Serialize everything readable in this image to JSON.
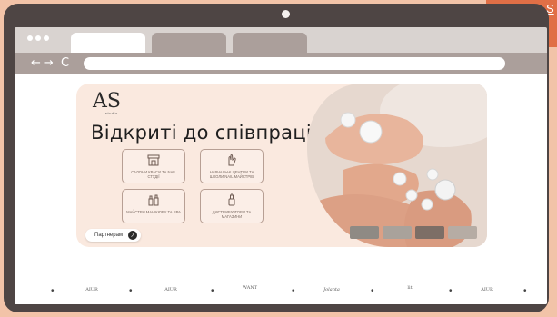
{
  "corner_tag": {
    "text": "S"
  },
  "browser": {
    "tabs": [
      {
        "label": "",
        "active": true
      },
      {
        "label": "",
        "active": false
      },
      {
        "label": "",
        "active": false
      }
    ],
    "nav_icons": [
      "back-arrow-icon",
      "forward-arrow-icon",
      "reload-icon"
    ],
    "nav_glyphs": {
      "back": "←",
      "forward": "→",
      "reload": "C"
    },
    "address": ""
  },
  "hero": {
    "logo": {
      "mark": "AS",
      "sub": "studio"
    },
    "headline": "Відкриті до співпраці",
    "features": [
      {
        "icon": "storefront-icon",
        "label": "салони краси та nail студії"
      },
      {
        "icon": "hand-icon",
        "label": "навчальні центри та школи nail майстрів"
      },
      {
        "icon": "bottles-icon",
        "label": "майстри манікюру та SPA"
      },
      {
        "icon": "bottle-icon",
        "label": "дистриб'ютори та магазини"
      }
    ],
    "partners_button": "Партнерам",
    "partners_arrow": "↗"
  },
  "brands": [
    "AIUR",
    "AIUR",
    "WANT",
    "Jolanta",
    "lit",
    "AIUR"
  ],
  "brand_separator": "•",
  "colors": {
    "background": "#f2c3a8",
    "accent": "#e06f46",
    "laptop_frame": "#4e4544",
    "hero_bg": "#fae9df"
  }
}
